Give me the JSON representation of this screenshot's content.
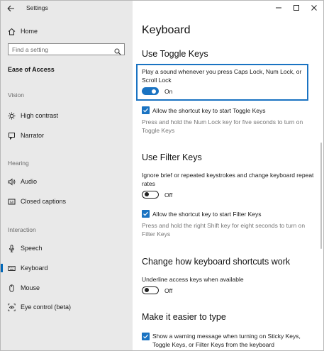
{
  "window": {
    "title": "Settings"
  },
  "sidebar": {
    "home_label": "Home",
    "search_placeholder": "Find a setting",
    "section_title": "Ease of Access",
    "groups": {
      "vision": "Vision",
      "hearing": "Hearing",
      "interaction": "Interaction"
    },
    "items": {
      "high_contrast": "High contrast",
      "narrator": "Narrator",
      "audio": "Audio",
      "closed_captions": "Closed captions",
      "speech": "Speech",
      "keyboard": "Keyboard",
      "mouse": "Mouse",
      "eye_control": "Eye control (beta)"
    },
    "selected_item": "keyboard"
  },
  "main": {
    "page_title": "Keyboard",
    "toggle_keys": {
      "heading": "Use Toggle Keys",
      "description": "Play a sound whenever you press Caps Lock, Num Lock, or Scroll Lock",
      "state_label": "On",
      "state": true,
      "shortcut_label": "Allow the shortcut key to start Toggle Keys",
      "shortcut_checked": true,
      "hint": "Press and hold the Num Lock key for five seconds to turn on Toggle Keys"
    },
    "filter_keys": {
      "heading": "Use Filter Keys",
      "description": "Ignore brief or repeated keystrokes and change keyboard repeat rates",
      "state_label": "Off",
      "state": false,
      "shortcut_label": "Allow the shortcut key to start Filter Keys",
      "shortcut_checked": true,
      "hint": "Press and hold the right Shift key for eight seconds to turn on Filter Keys"
    },
    "shortcuts": {
      "heading": "Change how keyboard shortcuts work",
      "description": "Underline access keys when available",
      "state_label": "Off",
      "state": false
    },
    "typing": {
      "heading": "Make it easier to type",
      "checkbox_label": "Show a warning message when turning on Sticky Keys, Toggle Keys, or Filter Keys from the keyboard",
      "checked": true
    }
  },
  "colors": {
    "accent": "#1a73c2",
    "sidebar_bg": "#e9e9e9",
    "hint_text": "#777777"
  }
}
